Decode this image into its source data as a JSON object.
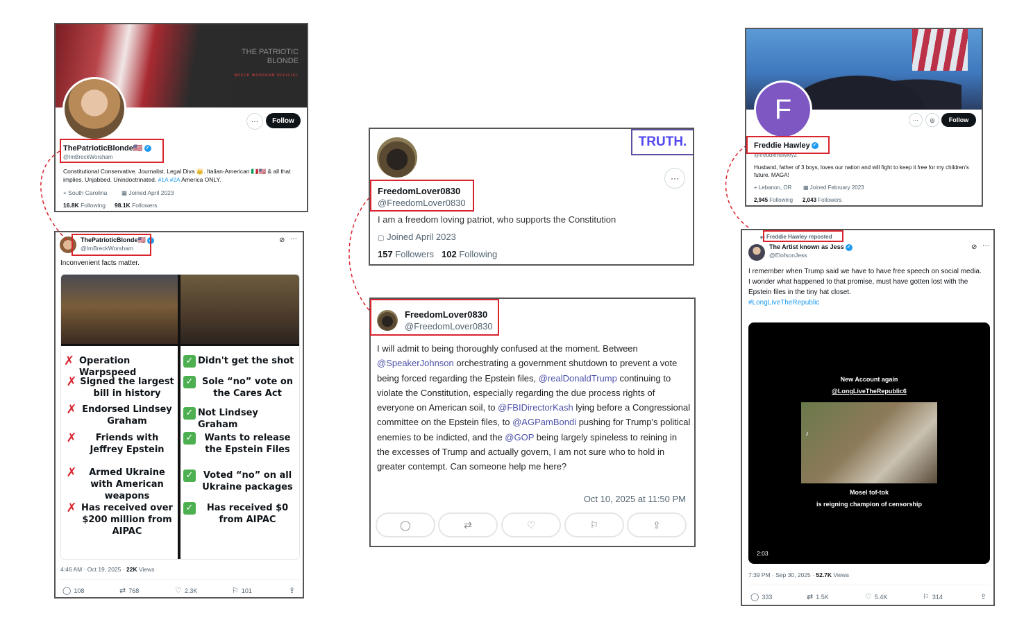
{
  "left_profile": {
    "banner_title": "THE PATRIOTIC BLONDE",
    "banner_subtitle": "BRECK WORSHAM OFFICIAL",
    "display_name": "ThePatrioticBlonde🇺🇸",
    "handle": "@ImBreckWorsham",
    "bio": "Constitutional Conservative. Journalist. Legal Diva 👑. Italian-American 🇮🇹🇺🇸 & all that implies. Unjabbed. Unindoctrinated.",
    "bio_tags": "#1A #2A",
    "bio_tail": "America ONLY.",
    "location": "South Carolina",
    "joined": "Joined April 2023",
    "following_count": "16.8K",
    "following_label": "Following",
    "followers_count": "98.1K",
    "followers_label": "Followers",
    "follow_label": "Follow",
    "more_label": "···"
  },
  "left_post": {
    "display_name": "ThePatrioticBlonde🇺🇸",
    "handle": "@ImBreckWorsham",
    "text": "Inconvenient facts matter.",
    "meme_left": [
      "Operation Warpspeed",
      "Signed the largest bill in history",
      "Endorsed Lindsey Graham",
      "Friends with Jeffrey Epstein",
      "Armed Ukraine with American weapons",
      "Has received over $200 million from AIPAC"
    ],
    "meme_right": [
      "Didn't get the shot",
      "Sole “no” vote on the Cares Act",
      "Not Lindsey Graham",
      "Wants to release the Epstein Files",
      "Voted “no” on all Ukraine packages",
      "Has received $0 from AIPAC"
    ],
    "timestamp": "4:46 AM · Oct 19, 2025 ·",
    "views_count": "22K",
    "views_label": "Views",
    "replies": "108",
    "reposts": "768",
    "likes": "2.3K",
    "bookmarks": "101"
  },
  "center_profile": {
    "truth_logo": "TRUTH.",
    "display_name": "FreedomLover0830",
    "handle": "@FreedomLover0830",
    "bio": "I am a freedom loving patriot, who supports the Constitution",
    "joined": "Joined April 2023",
    "followers_count": "157",
    "followers_label": "Followers",
    "following_count": "102",
    "following_label": "Following",
    "more_label": "···"
  },
  "center_post": {
    "display_name": "FreedomLover0830",
    "handle": "@FreedomLover0830",
    "text_parts": [
      "I will admit to being thoroughly confused at the moment. Between ",
      "@SpeakerJohnson",
      " orchestrating a government shutdown to prevent a vote being forced regarding the Epstein files, ",
      "@realDonaldTrump",
      " continuing to violate the Constitution, especially regarding the due process rights of everyone on American soil, to ",
      "@FBIDirectorKash",
      " lying before a Congressional committee on the Epstein files, to ",
      "@AGPamBondi",
      " pushing for Trump's political enemies to be indicted, and the ",
      "@GOP",
      " being largely spineless to reining in the excesses of Trump and actually govern, I am not sure who to hold in greater contempt. Can someone help me here?"
    ],
    "timestamp": "Oct 10, 2025 at 11:50 PM"
  },
  "right_profile": {
    "avatar_letter": "F",
    "display_name": "Freddie Hawley",
    "handle": "@freddiehawley2",
    "bio": "Husband, father of 3 boys, loves our nation and will fight to keep it free for my children's future.  MAGA!",
    "location": "Lebanon, OR",
    "joined": "Joined February 2023",
    "following_count": "2,945",
    "following_label": "Following",
    "followers_count": "2,043",
    "followers_label": "Followers",
    "follow_label": "Follow",
    "more_label": "···"
  },
  "right_post": {
    "repost_label": "Freddie Hawley reposted",
    "display_name": "The Artist known as Jess",
    "handle": "@ElofsonJess",
    "text_lines": [
      "I remember when Trump said we have to have free speech on social media.",
      "I wonder what happened to that promise, must have gotten lost with the Epstein files in the tiny hat closet."
    ],
    "hashtag": "#LongLiveTheRepublic",
    "video_caption_top": "New Account again",
    "video_caption_handle": "@LongLiveTheRepublic6",
    "video_caption_bottom1": "Mosel tof-tok",
    "video_caption_bottom2": "is reigning champion of censorship",
    "video_duration": "2:03",
    "timestamp": "7:39 PM · Sep 30, 2025 ·",
    "views_count": "52.7K",
    "views_label": "Views",
    "replies": "333",
    "reposts": "1.5K",
    "likes": "5.4K",
    "bookmarks": "314"
  },
  "colors": {
    "highlight_red": "#d9232d",
    "x_blue": "#1d9bf0",
    "truth_purple": "#5448ee"
  }
}
